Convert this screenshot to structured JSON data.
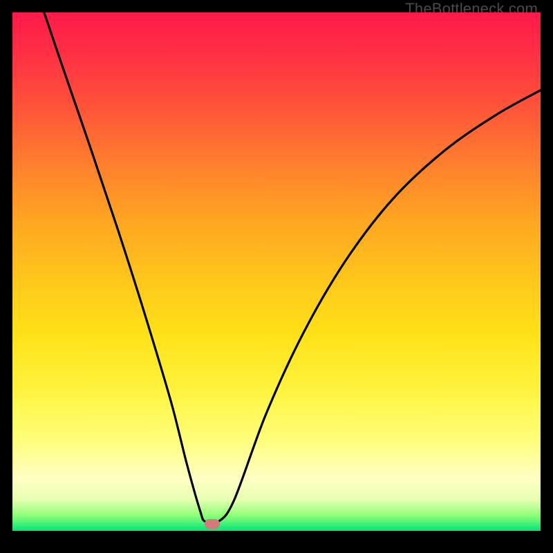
{
  "watermark": {
    "text": "TheBottleneck.com"
  },
  "marker": {
    "x_frac": 0.378,
    "y_frac": 0.986,
    "color": "#d47a7a"
  },
  "chart_data": {
    "type": "line",
    "title": "",
    "xlabel": "",
    "ylabel": "",
    "xlim": [
      0,
      1
    ],
    "ylim": [
      0,
      1
    ],
    "series": [
      {
        "name": "bottleneck-curve",
        "x": [
          0.06,
          0.1,
          0.15,
          0.2,
          0.25,
          0.3,
          0.33,
          0.355,
          0.365,
          0.39,
          0.42,
          0.48,
          0.55,
          0.63,
          0.72,
          0.82,
          0.92,
          1.0
        ],
        "y": [
          1.0,
          0.88,
          0.732,
          0.58,
          0.42,
          0.25,
          0.13,
          0.04,
          0.018,
          0.018,
          0.06,
          0.225,
          0.38,
          0.52,
          0.64,
          0.735,
          0.805,
          0.85
        ]
      }
    ],
    "gradient_stops": [
      {
        "pos": 0.0,
        "color": "#ff1a49"
      },
      {
        "pos": 0.5,
        "color": "#ffc81a"
      },
      {
        "pos": 0.82,
        "color": "#ffff78"
      },
      {
        "pos": 1.0,
        "color": "#00e676"
      }
    ],
    "annotations": [
      {
        "type": "marker",
        "label": "optimal-point",
        "x": 0.378,
        "y": 0.014
      }
    ]
  }
}
